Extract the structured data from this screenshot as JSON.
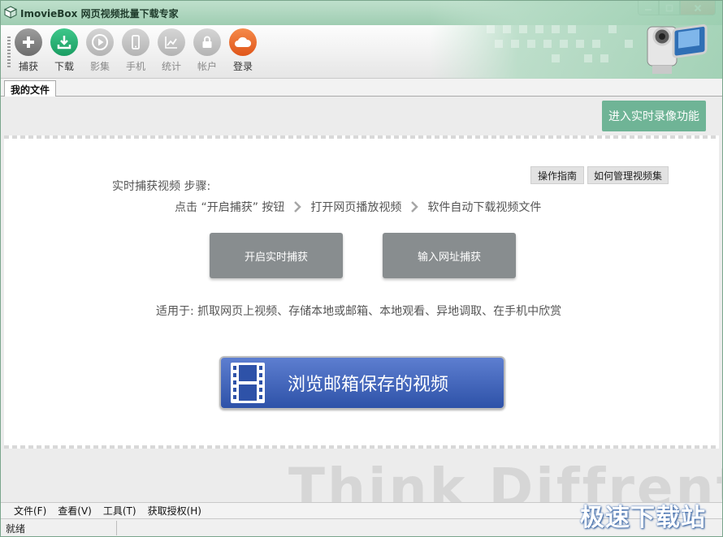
{
  "window": {
    "title": "ImovieBox 网页视频批量下载专家",
    "minimize_icon": "minimize-icon",
    "maximize_icon": "maximize-icon",
    "close_icon": "close-icon"
  },
  "toolbar": {
    "items": [
      {
        "label": "捕获",
        "icon": "plus-icon",
        "enabled": true
      },
      {
        "label": "下载",
        "icon": "download-icon",
        "enabled": true
      },
      {
        "label": "影集",
        "icon": "play-icon",
        "enabled": false
      },
      {
        "label": "手机",
        "icon": "phone-icon",
        "enabled": false
      },
      {
        "label": "统计",
        "icon": "chart-icon",
        "enabled": false
      },
      {
        "label": "帐户",
        "icon": "lock-icon",
        "enabled": false
      },
      {
        "label": "登录",
        "icon": "cloud-icon",
        "enabled": true
      }
    ]
  },
  "tabs": [
    {
      "label": "我的文件",
      "active": true
    }
  ],
  "main": {
    "record_button": "进入实时录像功能",
    "guide_button": "操作指南",
    "manage_button": "如何管理视频集",
    "steps_title": "实时捕获视频 步骤:",
    "steps": [
      "点击 “开启捕获” 按钮",
      "打开网页播放视频",
      "软件自动下载视频文件"
    ],
    "start_capture_button": "开启实时捕获",
    "url_capture_button": "输入网址捕获",
    "applies_text": "适用于: 抓取网页上视频、存储本地或邮箱、本地观看、异地调取、在手机中欣赏",
    "browse_button": "浏览邮箱保存的视频",
    "watermark": "Think Diffrent"
  },
  "menu": {
    "items": [
      "文件(F)",
      "查看(V)",
      "工具(T)",
      "获取授权(H)"
    ]
  },
  "status": {
    "text": "就绪"
  },
  "site_watermark": "极速下载站",
  "colors": {
    "accent_green": "#6fb496",
    "button_gray": "#888d8f",
    "browse_blue": "#2e52a8",
    "titlebar_green": "#9fcdb2"
  }
}
